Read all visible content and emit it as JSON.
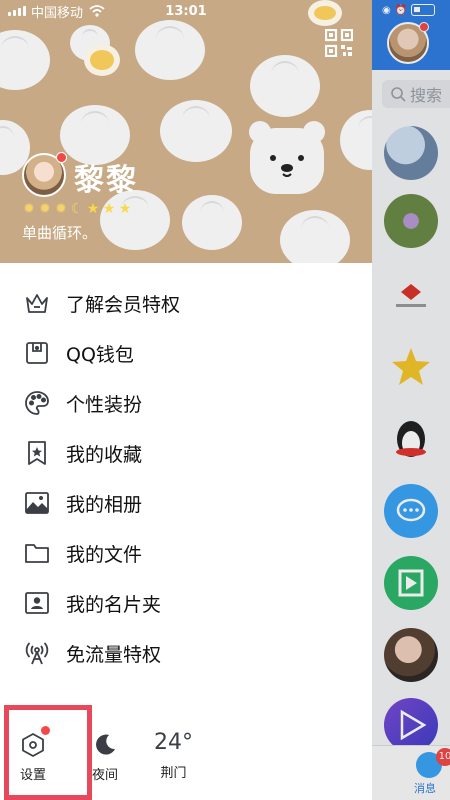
{
  "status_bar": {
    "carrier": "中国移动",
    "time": "13:01"
  },
  "profile": {
    "nickname": "黎黎",
    "signature": "单曲循环。",
    "level_icons": [
      "sun",
      "sun",
      "sun",
      "moon",
      "star",
      "star",
      "star"
    ]
  },
  "menu": {
    "items": [
      {
        "label": "了解会员特权",
        "icon": "crown-icon"
      },
      {
        "label": "QQ钱包",
        "icon": "wallet-icon"
      },
      {
        "label": "个性装扮",
        "icon": "palette-icon"
      },
      {
        "label": "我的收藏",
        "icon": "bookmark-star-icon"
      },
      {
        "label": "我的相册",
        "icon": "image-icon"
      },
      {
        "label": "我的文件",
        "icon": "folder-icon"
      },
      {
        "label": "我的名片夹",
        "icon": "contact-card-icon"
      },
      {
        "label": "免流量特权",
        "icon": "broadcast-tower-icon"
      }
    ]
  },
  "bottom": {
    "settings_label": "设置",
    "night_label": "夜间",
    "weather_temp": "24°",
    "weather_city": "荆门"
  },
  "peek": {
    "search_label": "搜索",
    "messages_label": "消息",
    "badge": "10"
  },
  "colors": {
    "hero_bg": "#c7a985",
    "accent": "#2f7de1",
    "highlight": "#e8485b",
    "badge": "#f24848"
  }
}
